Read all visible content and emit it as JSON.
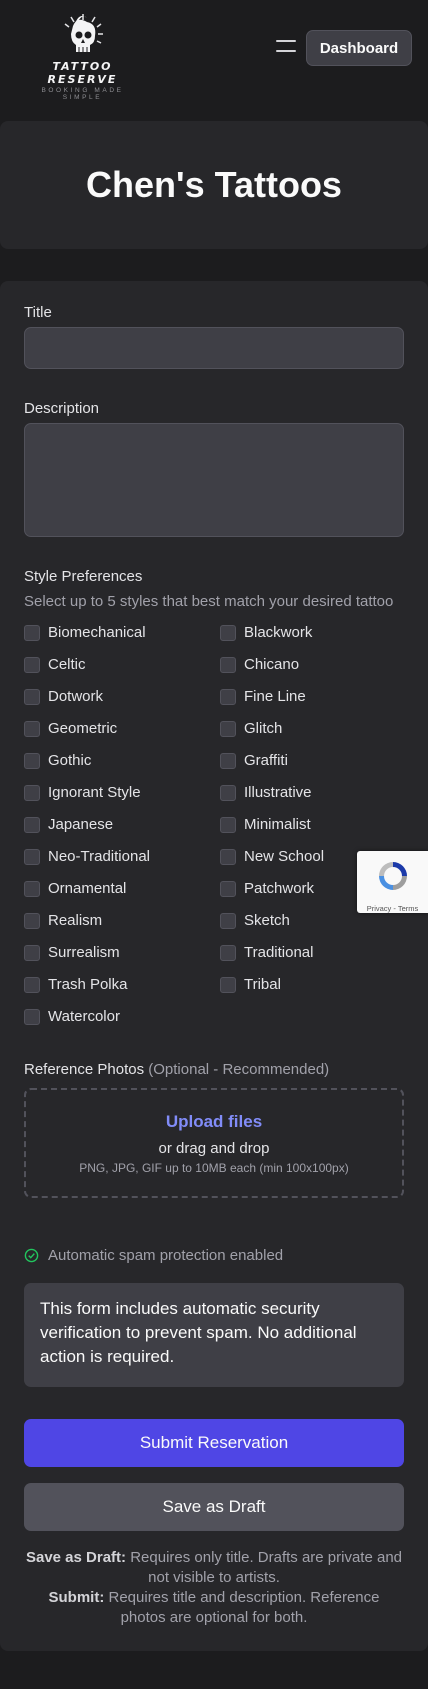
{
  "header": {
    "logo_title": "TATTOO RESERVE",
    "logo_tagline": "BOOKING MADE SIMPLE",
    "dashboard_label": "Dashboard"
  },
  "studio": {
    "name": "Chen's Tattoos"
  },
  "form": {
    "title_label": "Title",
    "title_value": "",
    "description_label": "Description",
    "description_value": "",
    "styles_label": "Style Preferences",
    "styles_hint": "Select up to 5 styles that best match your desired tattoo",
    "styles_left": [
      "Biomechanical",
      "Celtic",
      "Dotwork",
      "Geometric",
      "Gothic",
      "Ignorant Style",
      "Japanese",
      "Neo-Traditional",
      "Ornamental",
      "Realism",
      "Surrealism",
      "Trash Polka",
      "Watercolor"
    ],
    "styles_right": [
      "Blackwork",
      "Chicano",
      "Fine Line",
      "Glitch",
      "Graffiti",
      "Illustrative",
      "Minimalist",
      "New School",
      "Patchwork",
      "Sketch",
      "Traditional",
      "Tribal"
    ],
    "photos_label": "Reference Photos",
    "photos_optional": "(Optional - Recommended)",
    "upload_link": "Upload files",
    "upload_drag": "or drag and drop",
    "upload_formats": "PNG, JPG, GIF up to 10MB each (min 100x100px)",
    "spam_label": "Automatic spam protection enabled",
    "spam_info": "This form includes automatic security verification to prevent spam. No additional action is required.",
    "submit_label": "Submit Reservation",
    "draft_label": "Save as Draft",
    "note_draft_bold": "Save as Draft:",
    "note_draft_text": "Requires only title. Drafts are private and not visible to artists.",
    "note_submit_bold": "Submit:",
    "note_submit_text": "Requires title and description. Reference photos are optional for both."
  },
  "recaptcha": {
    "privacy": "Privacy",
    "sep": "-",
    "terms": "Terms"
  },
  "colors": {
    "accent": "#4f46e5",
    "link": "#818cf8",
    "check_ok": "#22c55e"
  }
}
